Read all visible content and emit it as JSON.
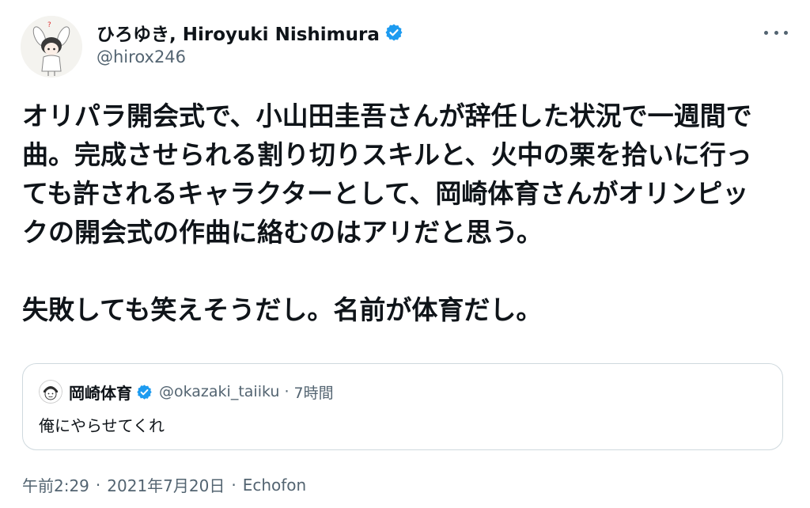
{
  "author": {
    "display_name": "ひろゆき, Hiroyuki Nishimura",
    "handle": "@hirox246",
    "verified": true
  },
  "tweet": {
    "text": "オリパラ開会式で、小山田圭吾さんが辞任した状況で一週間で曲。完成させられる割り切りスキルと、火中の栗を拾いに行っても許されるキャラクターとして、岡崎体育さんがオリンピックの開会式の作曲に絡むのはアリだと思う。\n\n失敗しても笑えそうだし。名前が体育だし。"
  },
  "quoted_tweet": {
    "display_name": "岡崎体育",
    "verified": true,
    "handle": "@okazaki_taiiku",
    "separator": "·",
    "time_ago": "7時間",
    "text": "俺にやらせてくれ"
  },
  "meta": {
    "time": "午前2:29",
    "separator": "·",
    "date": "2021年7月20日",
    "separator2": "·",
    "source": "Echofon"
  },
  "colors": {
    "text_primary": "#0f1419",
    "text_secondary": "#536471",
    "verified_blue": "#1d9bf0",
    "border": "#cfd9de"
  },
  "icons": {
    "more": "more-horizontal-icon",
    "verified": "verified-badge-icon"
  }
}
